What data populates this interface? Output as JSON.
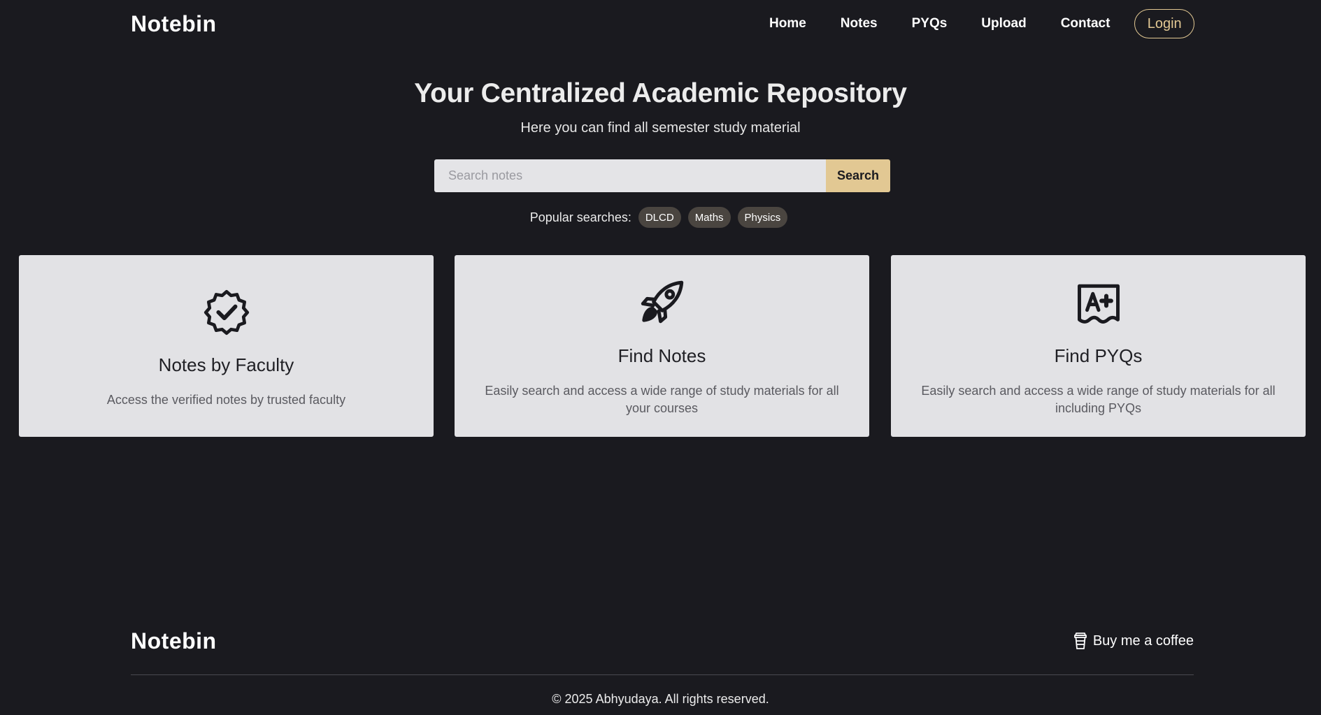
{
  "header": {
    "brand": "Notebin",
    "nav": [
      "Home",
      "Notes",
      "PYQs",
      "Upload",
      "Contact"
    ],
    "login_label": "Login"
  },
  "hero": {
    "title": "Your Centralized Academic Repository",
    "subtitle": "Here you can find all semester study material"
  },
  "search": {
    "placeholder": "Search notes",
    "value": "",
    "button_label": "Search"
  },
  "popular": {
    "label": "Popular searches:",
    "tags": [
      "DLCD",
      "Maths",
      "Physics"
    ]
  },
  "cards": [
    {
      "icon": "verified-badge-icon",
      "title": "Notes by Faculty",
      "description": "Access the verified notes by trusted faculty"
    },
    {
      "icon": "rocket-icon",
      "title": "Find Notes",
      "description": "Easily search and access a wide range of study materials for all your courses"
    },
    {
      "icon": "grade-a-plus-icon",
      "title": "Find PYQs",
      "description": "Easily search and access a wide range of study materials for all including PYQs"
    }
  ],
  "footer": {
    "brand": "Notebin",
    "coffee_label": "Buy me a coffee",
    "copyright": "© 2025 Abhyudaya. All rights reserved."
  },
  "colors": {
    "background": "#1a1a1f",
    "accent": "#e2c893",
    "card_background": "#e2e2e5",
    "chip_background": "#4a4540"
  }
}
